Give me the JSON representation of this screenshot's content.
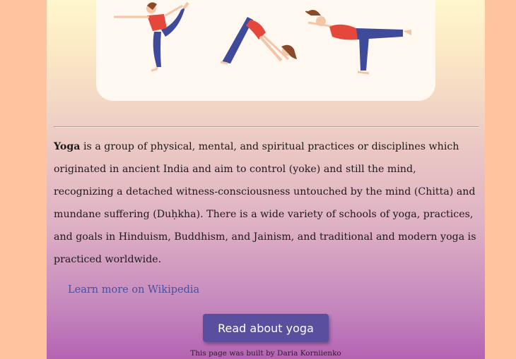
{
  "article": {
    "term": "Yoga",
    "description": " is a group of physical, mental, and spiritual practices or disciplines which originated in ancient India and aim to control (yoke) and still the mind, recognizing a detached witness-consciousness untouched by the mind (Chitta) and mundane suffering (Duḥkha). There is a wide variety of schools of yoga, practices, and goals in Hinduism, Buddhism, and Jainism, and traditional and modern yoga is practiced worldwide."
  },
  "links": {
    "wikipedia": "Learn more on Wikipedia"
  },
  "actions": {
    "read_button": "Read about yoga"
  },
  "footer": {
    "credit": "This page was built by Daria Korniienko"
  },
  "colors": {
    "outer_background": "#ffc3a0",
    "button": "#5a4f9e",
    "link": "#4a4fa0",
    "illustration_top": "#e5473a",
    "illustration_pants": "#3f4a9a",
    "illustration_skin": "#f5c5a8",
    "illustration_hair": "#8a4a2a"
  },
  "illustration": {
    "icon": "yoga-poses-illustration"
  }
}
